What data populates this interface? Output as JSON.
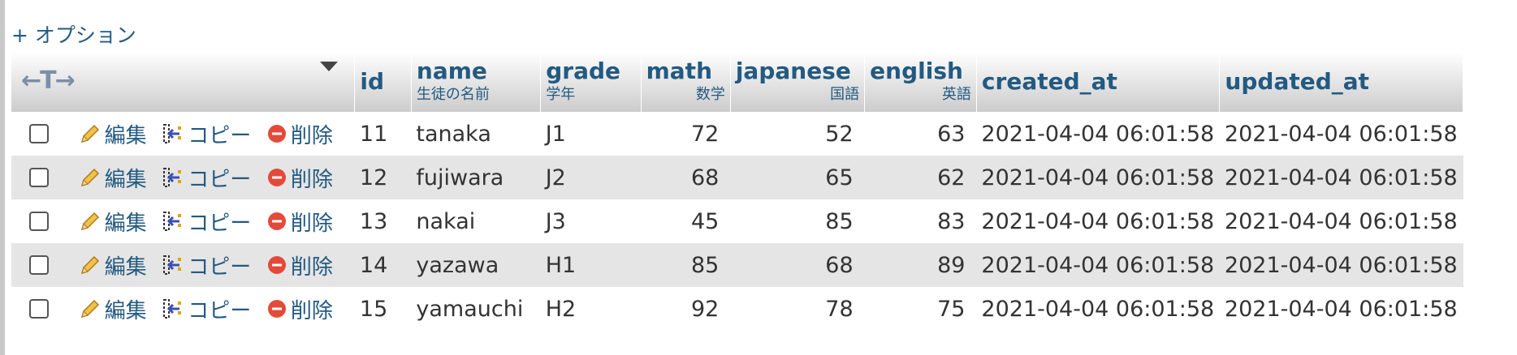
{
  "options_label": "+ オプション",
  "columns": [
    {
      "name": "id",
      "sub": ""
    },
    {
      "name": "name",
      "sub": "生徒の名前"
    },
    {
      "name": "grade",
      "sub": "学年"
    },
    {
      "name": "math",
      "sub": "数学"
    },
    {
      "name": "japanese",
      "sub": "国語"
    },
    {
      "name": "english",
      "sub": "英語"
    },
    {
      "name": "created_at",
      "sub": ""
    },
    {
      "name": "updated_at",
      "sub": ""
    }
  ],
  "actions": {
    "edit": "編集",
    "copy": "コピー",
    "delete": "削除"
  },
  "icons": {
    "arrows": "←T→",
    "edit": "pencil-icon",
    "copy": "copy-insert-icon",
    "delete": "delete-icon",
    "sort": "sort-triangle-icon"
  },
  "rows": [
    {
      "id": "11",
      "name": "tanaka",
      "grade": "J1",
      "math": "72",
      "japanese": "52",
      "english": "63",
      "created_at": "2021-04-04 06:01:58",
      "updated_at": "2021-04-04 06:01:58"
    },
    {
      "id": "12",
      "name": "fujiwara",
      "grade": "J2",
      "math": "68",
      "japanese": "65",
      "english": "62",
      "created_at": "2021-04-04 06:01:58",
      "updated_at": "2021-04-04 06:01:58"
    },
    {
      "id": "13",
      "name": "nakai",
      "grade": "J3",
      "math": "45",
      "japanese": "85",
      "english": "83",
      "created_at": "2021-04-04 06:01:58",
      "updated_at": "2021-04-04 06:01:58"
    },
    {
      "id": "14",
      "name": "yazawa",
      "grade": "H1",
      "math": "85",
      "japanese": "68",
      "english": "89",
      "created_at": "2021-04-04 06:01:58",
      "updated_at": "2021-04-04 06:01:58"
    },
    {
      "id": "15",
      "name": "yamauchi",
      "grade": "H2",
      "math": "92",
      "japanese": "78",
      "english": "75",
      "created_at": "2021-04-04 06:01:58",
      "updated_at": "2021-04-04 06:01:58"
    }
  ]
}
